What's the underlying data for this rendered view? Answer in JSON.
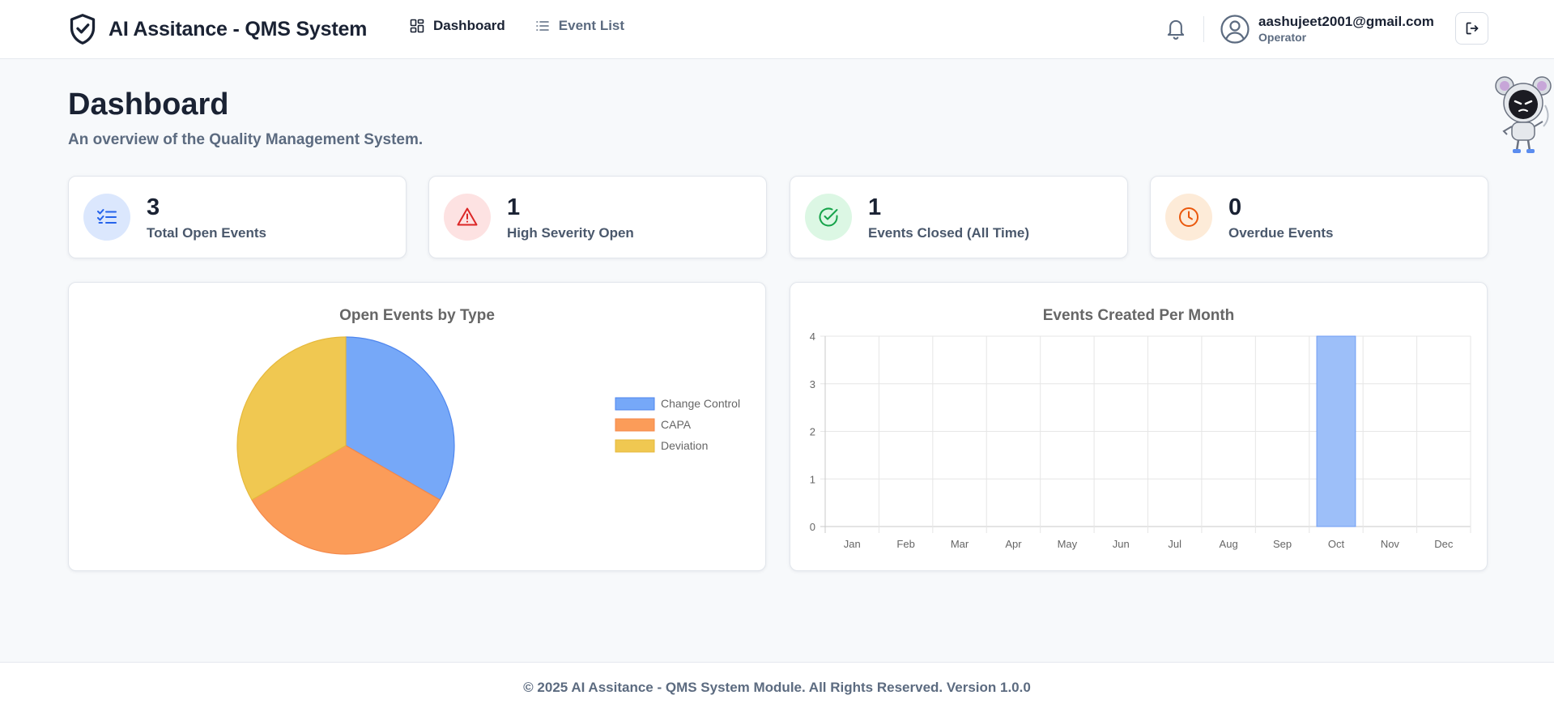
{
  "app": {
    "title": "AI Assitance - QMS System",
    "nav": [
      {
        "label": "Dashboard",
        "icon": "grid-icon",
        "active": true
      },
      {
        "label": "Event List",
        "icon": "list-icon",
        "active": false
      }
    ],
    "user": {
      "email": "aashujeet2001@gmail.com",
      "role": "Operator"
    }
  },
  "page": {
    "title": "Dashboard",
    "subtitle": "An overview of the Quality Management System."
  },
  "stats": [
    {
      "value": "3",
      "label": "Total Open Events",
      "icon": "list-check-icon",
      "color": "#2563eb",
      "bg": "#dbe7fd"
    },
    {
      "value": "1",
      "label": "High Severity Open",
      "icon": "alert-triangle-icon",
      "color": "#dc2626",
      "bg": "#fde2e2"
    },
    {
      "value": "1",
      "label": "Events Closed (All Time)",
      "icon": "check-circle-icon",
      "color": "#16a34a",
      "bg": "#dcf7e4"
    },
    {
      "value": "0",
      "label": "Overdue Events",
      "icon": "clock-icon",
      "color": "#ea580c",
      "bg": "#fdebd8"
    }
  ],
  "chart_data": [
    {
      "type": "pie",
      "title": "Open Events by Type",
      "categories": [
        "Change Control",
        "CAPA",
        "Deviation"
      ],
      "values": [
        1,
        1,
        1
      ],
      "colors": [
        "#76a8f8",
        "#fb9c59",
        "#f0c851"
      ],
      "borders": [
        "#4f86ee",
        "#f4884a",
        "#e6b93c"
      ],
      "legend": "right"
    },
    {
      "type": "bar",
      "title": "Events Created Per Month",
      "categories": [
        "Jan",
        "Feb",
        "Mar",
        "Apr",
        "May",
        "Jun",
        "Jul",
        "Aug",
        "Sep",
        "Oct",
        "Nov",
        "Dec"
      ],
      "values": [
        0,
        0,
        0,
        0,
        0,
        0,
        0,
        0,
        0,
        4,
        0,
        0
      ],
      "ylim": [
        0,
        4
      ],
      "yticks": [
        "0",
        "1",
        "2",
        "3",
        "4"
      ],
      "color": "#9dbff9",
      "border": "#6f9ef4",
      "grid": true
    }
  ],
  "footer": {
    "text": "© 2025 AI Assitance - QMS System Module. All Rights Reserved. Version 1.0.0"
  }
}
